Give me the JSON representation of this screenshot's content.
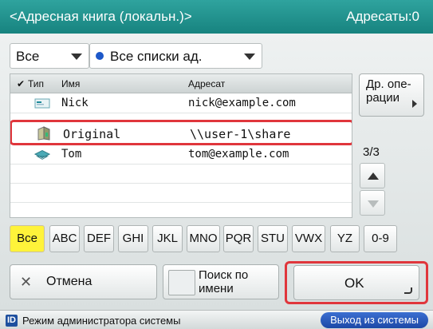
{
  "titlebar": {
    "title": "<Адресная книга (локальн.)>",
    "count": "Адресаты:0"
  },
  "filters": {
    "type": "Все",
    "list": "Все списки ад."
  },
  "table": {
    "headers": {
      "type": "Тип",
      "name": "Имя",
      "address": "Адресат"
    },
    "rows": [
      {
        "name": "Nick",
        "address": "nick@example.com",
        "icon": "email-icon"
      },
      {
        "name": "Original",
        "address": "\\\\user-1\\share",
        "icon": "file-server-icon"
      },
      {
        "name": "Tom",
        "address": "tom@example.com",
        "icon": "group-icon"
      }
    ]
  },
  "side": {
    "other_ops": "Др. опе-рации",
    "page": "3/3"
  },
  "letters": [
    "Все",
    "ABC",
    "DEF",
    "GHI",
    "JKL",
    "MNO",
    "PQR",
    "STU",
    "VWX",
    "YZ",
    "0-9"
  ],
  "actions": {
    "cancel": "Отмена",
    "search": "Поиск по имени",
    "ok": "OK"
  },
  "status": {
    "mode": "Режим администратора системы",
    "logout": "Выход из системы",
    "badge": "ID"
  },
  "colors": {
    "title_bar": "#1f938f",
    "highlight": "#e0363c",
    "selected_filter": "#fff33a"
  }
}
